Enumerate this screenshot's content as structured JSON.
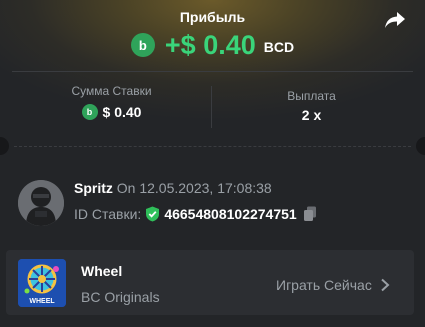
{
  "header": {
    "title": "Прибыль",
    "profit_amount": "+$ 0.40",
    "currency": "BCD"
  },
  "stats": {
    "bet_label": "Сумма Ставки",
    "bet_value": "$ 0.40",
    "payout_label": "Выплата",
    "payout_value": "2 x"
  },
  "user": {
    "name": "Spritz",
    "date": "On 12.05.2023, 17:08:38",
    "bet_id_label": "ID Ставки:",
    "bet_id": "466548081022747​51"
  },
  "game": {
    "name": "Wheel",
    "provider": "BC Originals",
    "thumb_label": "WHEEL",
    "play_label": "Играть Сейчас"
  },
  "colors": {
    "profit_green": "#3ad47a",
    "coin_green": "#2fa35a",
    "background": "#232528",
    "muted_text": "#9aa0a6"
  },
  "icons": {
    "share": "share-icon",
    "coin": "bcd-coin-icon",
    "verified": "shield-check-icon",
    "copy": "copy-icon",
    "chevron": "chevron-right-icon"
  }
}
